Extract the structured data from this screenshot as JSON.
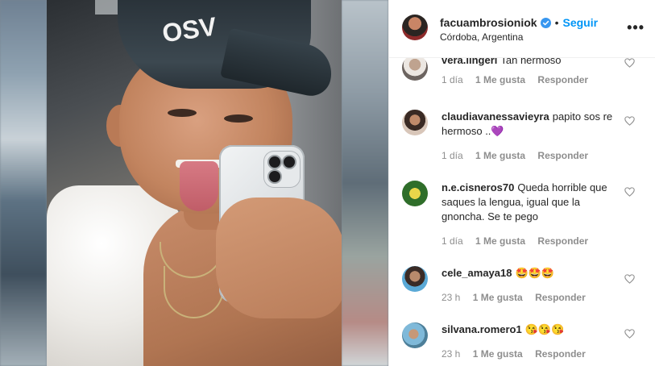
{
  "post": {
    "username": "facuambrosioniok",
    "location": "Córdoba, Argentina",
    "follow_label": "Seguir",
    "separator": "•",
    "more_label": "•••",
    "cap_text": "OSV"
  },
  "comments": [
    {
      "user": "vera.lingeri",
      "text": "Tan hermoso",
      "time": "1 día",
      "likes": "1 Me gusta",
      "reply": "Responder"
    },
    {
      "user": "claudiavanessavieyra",
      "text": "papito sos re hermoso ..💜",
      "time": "1 día",
      "likes": "1 Me gusta",
      "reply": "Responder"
    },
    {
      "user": "n.e.cisneros70",
      "text": "Queda horrible que saques la lengua, igual que la gnoncha. Se te pego",
      "time": "1 día",
      "likes": "1 Me gusta",
      "reply": "Responder"
    },
    {
      "user": "cele_amaya18",
      "text": "🤩🤩🤩",
      "time": "23 h",
      "likes": "1 Me gusta",
      "reply": "Responder"
    },
    {
      "user": "silvana.romero1",
      "text": "😘😘😘",
      "time": "23 h",
      "likes": "1 Me gusta",
      "reply": "Responder"
    }
  ],
  "colors": {
    "accent": "#0095f6",
    "muted": "#8e8e8e",
    "text": "#262626"
  }
}
